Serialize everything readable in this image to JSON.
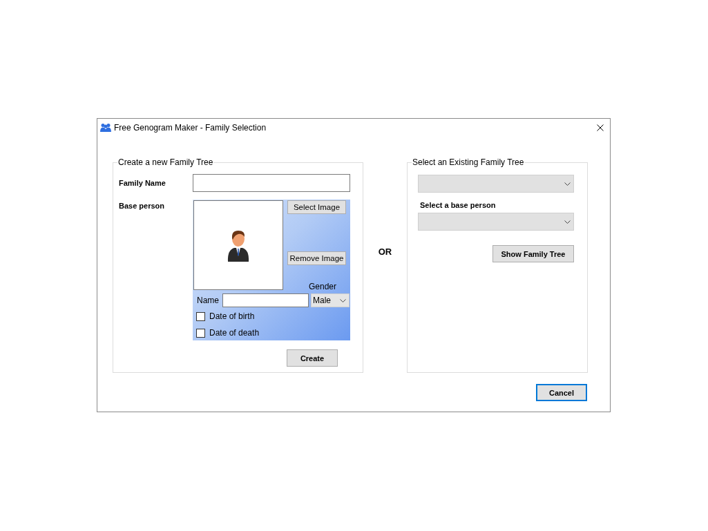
{
  "window": {
    "title": "Free Genogram Maker - Family Selection"
  },
  "create_group": {
    "legend": "Create a new Family Tree",
    "family_name_label": "Family Name",
    "base_person_label": "Base person",
    "select_image_button": "Select Image",
    "remove_image_button": "Remove Image",
    "gender_label": "Gender",
    "name_label": "Name",
    "gender_value": "Male",
    "checkboxes": [
      {
        "label": "Date of birth",
        "checked": false
      },
      {
        "label": "Date of death",
        "checked": false
      }
    ],
    "create_button": "Create"
  },
  "or_label": "OR",
  "existing_group": {
    "legend": "Select an Existing Family Tree",
    "base_person_label": "Select a base person",
    "show_button": "Show Family Tree"
  },
  "cancel_button": {
    "label": "Cancel",
    "focused": true
  }
}
